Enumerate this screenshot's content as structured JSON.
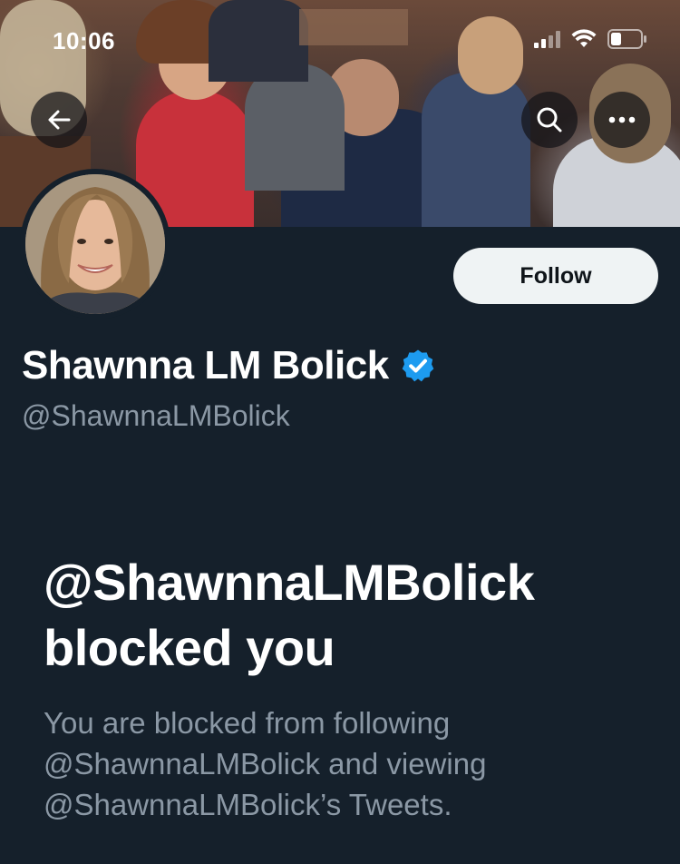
{
  "status_bar": {
    "time": "10:06",
    "icons": [
      "signal-icon",
      "wifi-icon",
      "battery-icon"
    ]
  },
  "header": {
    "back_icon": "arrow-left-icon",
    "search_icon": "search-icon",
    "more_icon": "more-horizontal-icon"
  },
  "profile": {
    "follow_label": "Follow",
    "display_name": "Shawnna LM Bolick",
    "verified_icon": "verified-badge-icon",
    "handle": "@ShawnnaLMBolick"
  },
  "blocked": {
    "title_line1": "@ShawnnaLMBolick",
    "title_line2": "blocked you",
    "desc_line1": "You are blocked from following",
    "desc_line2": "@ShawnnaLMBolick and viewing",
    "desc_line3": "@ShawnnaLMBolick’s Tweets."
  },
  "colors": {
    "background": "#15202b",
    "primary_text": "#ffffff",
    "secondary_text": "#8b98a5",
    "follow_button_bg": "#eff3f4",
    "verified_blue": "#1d9bf0"
  }
}
